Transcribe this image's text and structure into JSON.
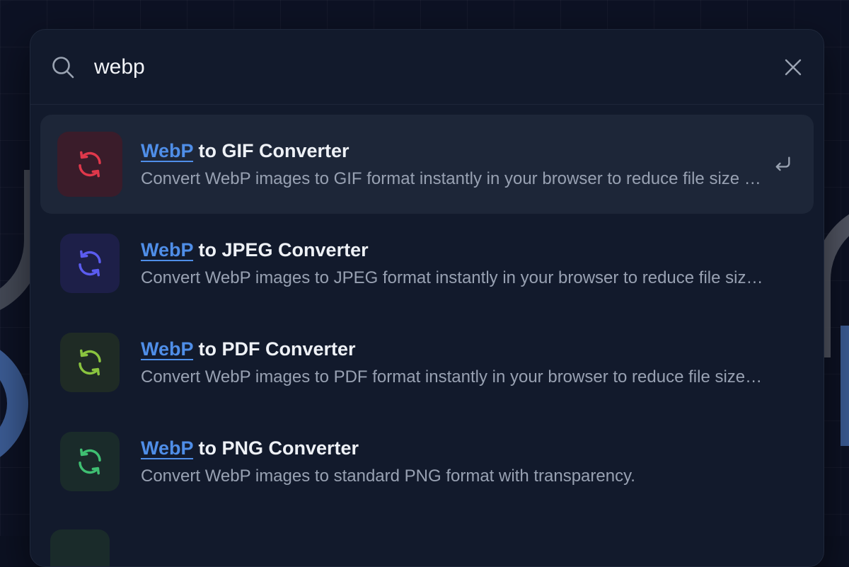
{
  "search": {
    "value": "webp",
    "icon": "search-icon",
    "clear_icon": "close-icon"
  },
  "results": [
    {
      "highlight": "WebP",
      "rest": " to GIF Converter",
      "description": "Convert WebP images to GIF format instantly in your browser to reduce file size and improve compatibility.",
      "icon": "convert-icon",
      "icon_color": "#e0384b",
      "icon_bg": "#3a1c2a",
      "active": true
    },
    {
      "highlight": "WebP",
      "rest": " to JPEG Converter",
      "description": "Convert WebP images to JPEG format instantly in your browser to reduce file size and improve compatibility.",
      "icon": "convert-icon",
      "icon_color": "#5b5cf0",
      "icon_bg": "#1d1f48",
      "active": false
    },
    {
      "highlight": "WebP",
      "rest": " to PDF Converter",
      "description": "Convert WebP images to PDF format instantly in your browser to reduce file size and improve compatibility.",
      "icon": "convert-icon",
      "icon_color": "#8ac43f",
      "icon_bg": "#1f2b25",
      "active": false
    },
    {
      "highlight": "WebP",
      "rest": " to PNG Converter",
      "description": "Convert WebP images to standard PNG format with transparency.",
      "icon": "convert-icon",
      "icon_color": "#3fbf72",
      "icon_bg": "#1a2b2a",
      "active": false
    }
  ],
  "enter_icon": "enter-key-icon",
  "colors": {
    "highlight": "#4f8ee8",
    "panel": "#121a2c",
    "active_row": "#1d2638"
  }
}
